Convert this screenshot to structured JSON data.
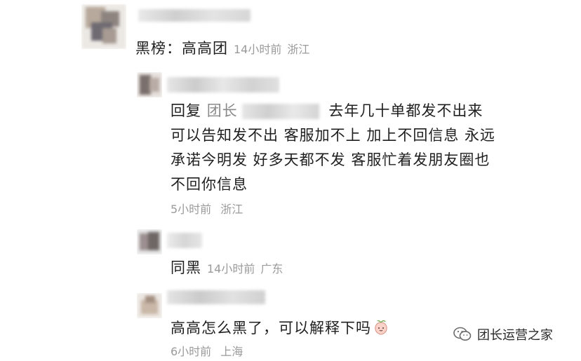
{
  "comment1": {
    "text": "黑榜：高高团",
    "time": "14小时前",
    "location": "浙江"
  },
  "reply1": {
    "reply_prefix": "回复",
    "reply_target": "团长",
    "text": "去年几十单都发不出来 可以告知发不出 客服加不上 加上不回信息 永远承诺今明发 好多天都不发 客服忙着发朋友圈也不回你信息",
    "time": "5小时前",
    "location": "浙江"
  },
  "reply2": {
    "text": "同黑",
    "time": "14小时前",
    "location": "广东"
  },
  "reply3": {
    "text": "高高怎么黑了，可以解释下吗",
    "emoji_icon": "peach-face-emoji-icon",
    "time": "6小时前",
    "location": "上海"
  },
  "watermark": {
    "icon": "wechat-official-account-icon",
    "text": "团长运营之家"
  },
  "colors": {
    "text_primary": "#1f1f1f",
    "text_meta": "#9a9a9a",
    "reply_target": "#8a8a8a"
  }
}
